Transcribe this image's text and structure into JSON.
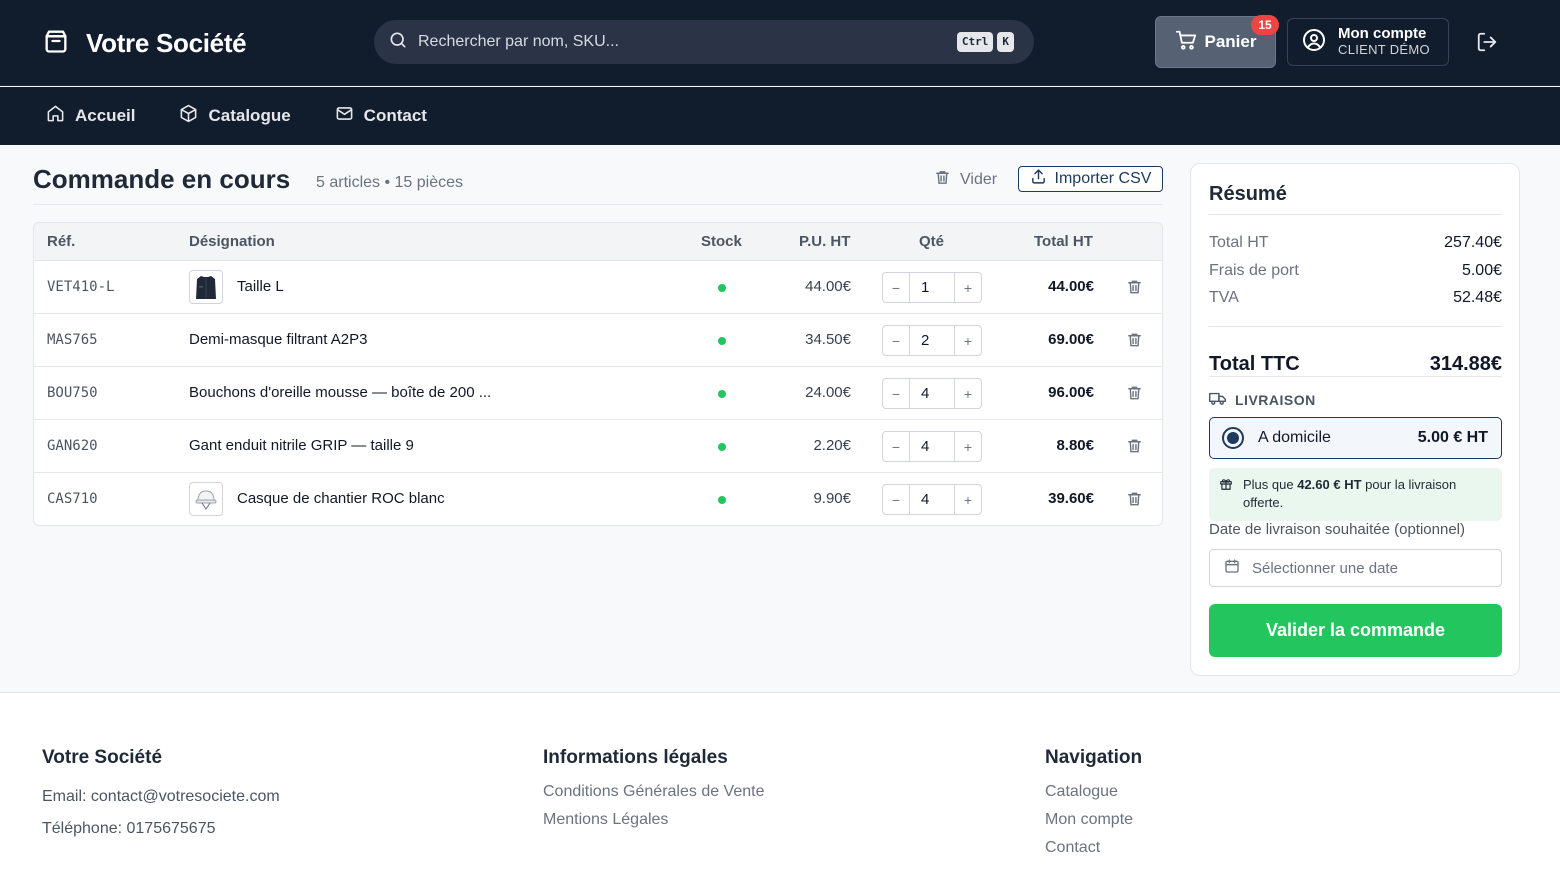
{
  "header": {
    "brand": "Votre Société",
    "search_placeholder": "Rechercher par nom, SKU...",
    "shortcut_keys": [
      "Ctrl",
      "K"
    ],
    "cart_label": "Panier",
    "cart_count": "15",
    "account_title": "Mon compte",
    "account_sub": "CLIENT DÉMO"
  },
  "nav": {
    "items": [
      {
        "label": "Accueil",
        "icon": "home-icon"
      },
      {
        "label": "Catalogue",
        "icon": "box-icon"
      },
      {
        "label": "Contact",
        "icon": "mail-icon"
      }
    ]
  },
  "main": {
    "title": "Commande en cours",
    "subtitle": "5 articles • 15 pièces",
    "clear_label": "Vider",
    "import_label": "Importer CSV",
    "columns": [
      "Réf.",
      "Désignation",
      "Stock",
      "P.U. HT",
      "Qté",
      "Total HT"
    ],
    "rows": [
      {
        "ref": "VET410-L",
        "designation": "Taille L",
        "thumb": "jacket",
        "in_stock": true,
        "unit_price": "44.00€",
        "qty": "1",
        "total": "44.00€"
      },
      {
        "ref": "MAS765",
        "designation": "Demi-masque filtrant A2P3",
        "thumb": null,
        "in_stock": true,
        "unit_price": "34.50€",
        "qty": "2",
        "total": "69.00€"
      },
      {
        "ref": "BOU750",
        "designation": "Bouchons d'oreille mousse — boîte de 200 ...",
        "thumb": null,
        "in_stock": true,
        "unit_price": "24.00€",
        "qty": "4",
        "total": "96.00€"
      },
      {
        "ref": "GAN620",
        "designation": "Gant enduit nitrile GRIP — taille 9",
        "thumb": null,
        "in_stock": true,
        "unit_price": "2.20€",
        "qty": "4",
        "total": "8.80€"
      },
      {
        "ref": "CAS710",
        "designation": "Casque de chantier ROC blanc",
        "thumb": "helmet",
        "in_stock": true,
        "unit_price": "9.90€",
        "qty": "4",
        "total": "39.60€"
      }
    ]
  },
  "summary": {
    "title": "Résumé",
    "lines": [
      {
        "label": "Total HT",
        "value": "257.40€"
      },
      {
        "label": "Frais de port",
        "value": "5.00€"
      },
      {
        "label": "TVA",
        "value": "52.48€"
      }
    ],
    "total_label": "Total TTC",
    "total_value": "314.88€",
    "delivery_heading": "LIVRAISON",
    "delivery_option": "A domicile",
    "delivery_price": "5.00 € HT",
    "free_prefix": "Plus que",
    "free_amount": "42.60 € HT",
    "free_suffix": "pour la livraison offerte.",
    "date_label": "Date de livraison souhaitée (optionnel)",
    "date_placeholder": "Sélectionner une date",
    "submit_label": "Valider la commande"
  },
  "footer": {
    "company": "Votre Société",
    "email": "Email: contact@votresociete.com",
    "phone": "Téléphone: 0175675675",
    "legal_heading": "Informations légales",
    "legal_links": [
      "Conditions Générales de Vente",
      "Mentions Légales"
    ],
    "nav_heading": "Navigation",
    "nav_links": [
      "Catalogue",
      "Mon compte",
      "Contact"
    ]
  },
  "colors": {
    "header_bg": "#111c2d",
    "accent": "#1e3a5f",
    "success": "#22c55e",
    "badge": "#ef4444"
  }
}
